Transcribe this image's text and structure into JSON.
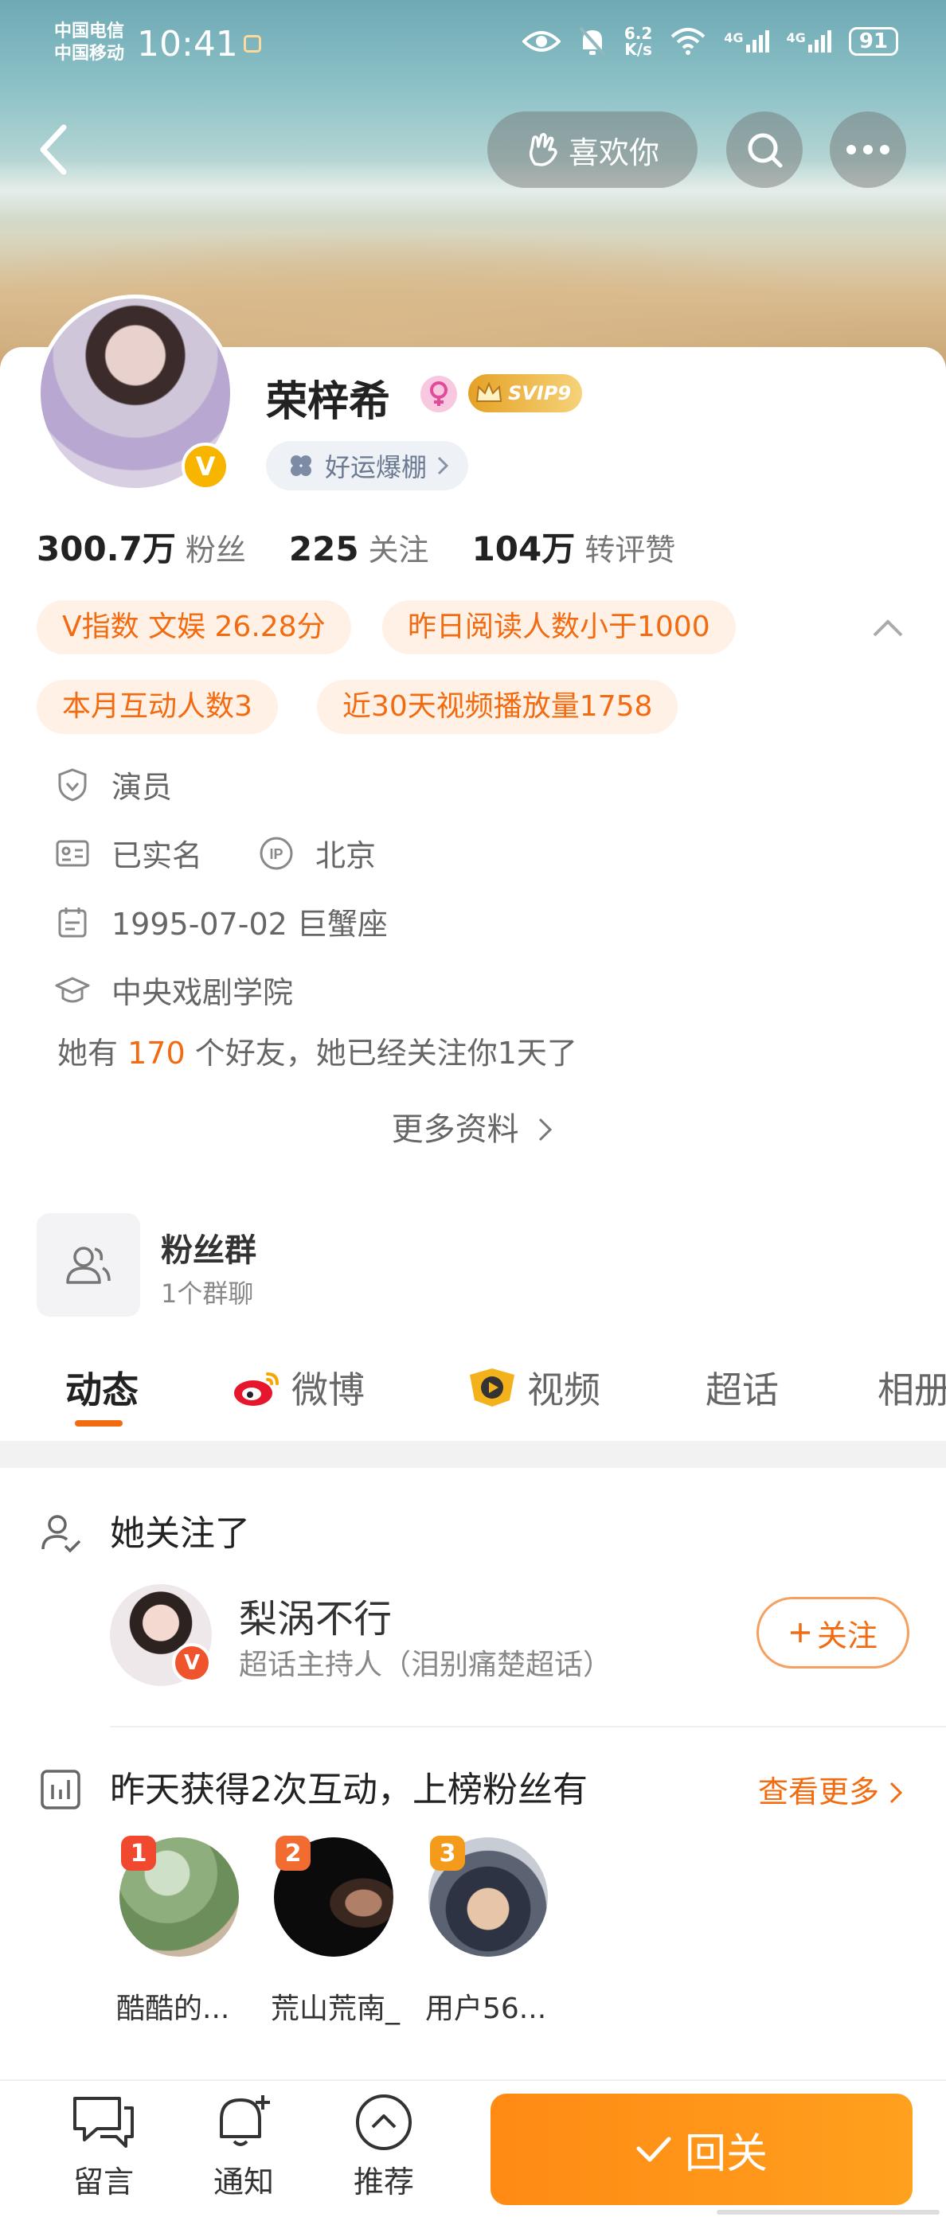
{
  "status_bar": {
    "carrier_1": "中国电信",
    "carrier_2": "中国移动",
    "time": "10:41",
    "speed": "6.2",
    "speed_unit": "K/s",
    "network_1": "4G",
    "network_2": "4G",
    "battery": "91"
  },
  "top_nav": {
    "like_label": "喜欢你"
  },
  "profile": {
    "name": "荣梓希",
    "svip": "SVIP9",
    "luck_label": "好运爆棚",
    "stats": [
      {
        "value": "300.7万",
        "label": "粉丝"
      },
      {
        "value": "225",
        "label": "关注"
      },
      {
        "value": "104万",
        "label": "转评赞"
      }
    ],
    "tags": [
      "V指数 文娱 26.28分",
      "昨日阅读人数小于1000",
      "本月互动人数3",
      "近30天视频播放量1758"
    ],
    "occupation": "演员",
    "verified": "已实名",
    "ip_location": "北京",
    "birthday": "1995-07-02 巨蟹座",
    "school": "中央戏剧学院",
    "friends_prefix": "她有",
    "friends_count": "170",
    "friends_suffix": "个好友，她已经关注你1天了",
    "more_info": "更多资料"
  },
  "fan_group": {
    "title": "粉丝群",
    "subtitle": "1个群聊"
  },
  "tabs": [
    {
      "label": "动态"
    },
    {
      "label": "微博"
    },
    {
      "label": "视频"
    },
    {
      "label": "超话"
    },
    {
      "label": "相册"
    }
  ],
  "following_section": {
    "title": "她关注了",
    "user_name": "梨涡不行",
    "user_desc": "超话主持人（泪别痛楚超话）",
    "follow_label": "关注"
  },
  "interaction_section": {
    "title": "昨天获得2次互动，上榜粉丝有",
    "see_more": "查看更多",
    "fans": [
      {
        "rank": "1",
        "name": "酷酷的...",
        "rank_color": "#f0492f"
      },
      {
        "rank": "2",
        "name": "荒山荒南_",
        "rank_color": "#f26b30"
      },
      {
        "rank": "3",
        "name": "用户56...",
        "rank_color": "#f59b1b"
      }
    ]
  },
  "bottom_bar": {
    "message": "留言",
    "notify": "通知",
    "recommend": "推荐",
    "follow_back": "回关"
  }
}
